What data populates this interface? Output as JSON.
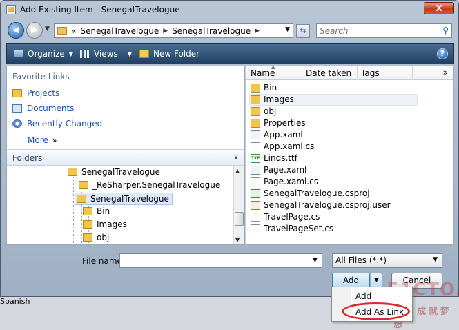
{
  "window": {
    "title": "Add Existing Item - SenegalTravelogue",
    "close_label": "X"
  },
  "nav": {
    "breadcrumb_prefix": "«",
    "breadcrumb": [
      "SenegalTravelogue",
      "SenegalTravelogue"
    ],
    "search_placeholder": "Search"
  },
  "toolbar": {
    "organize": "Organize",
    "views": "Views",
    "new_folder": "New Folder",
    "help": "?"
  },
  "favorites": {
    "title": "Favorite Links",
    "items": [
      {
        "label": "Projects",
        "icon": "folder-icon"
      },
      {
        "label": "Documents",
        "icon": "documents-icon"
      },
      {
        "label": "Recently Changed",
        "icon": "recently-changed-icon"
      }
    ],
    "more": "More",
    "more_arrow": "»"
  },
  "folders": {
    "title": "Folders",
    "caret": "∨",
    "tree": [
      {
        "label": "SenegalTravelogue",
        "indent": 1
      },
      {
        "label": "_ReSharper.SenegalTravelogue",
        "indent": 2
      },
      {
        "label": "SenegalTravelogue",
        "indent": 2,
        "selected": true
      },
      {
        "label": "Bin",
        "indent": 3
      },
      {
        "label": "Images",
        "indent": 3
      },
      {
        "label": "obj",
        "indent": 3
      }
    ]
  },
  "columns": {
    "name": "Name",
    "date": "Date taken",
    "tags": "Tags",
    "more": "»"
  },
  "files": [
    {
      "name": "Bin",
      "type": "folder"
    },
    {
      "name": "Images",
      "type": "folder"
    },
    {
      "name": "obj",
      "type": "folder"
    },
    {
      "name": "Properties",
      "type": "folder"
    },
    {
      "name": "App.xaml",
      "type": "xaml"
    },
    {
      "name": "App.xaml.cs",
      "type": "cs"
    },
    {
      "name": "Linds.ttf",
      "type": "ttf"
    },
    {
      "name": "Page.xaml",
      "type": "xaml"
    },
    {
      "name": "Page.xaml.cs",
      "type": "cs"
    },
    {
      "name": "SenegalTravelogue.csproj",
      "type": "proj"
    },
    {
      "name": "SenegalTravelogue.csproj.user",
      "type": "user"
    },
    {
      "name": "TravelPage.cs",
      "type": "cs"
    },
    {
      "name": "TravelPageSet.cs",
      "type": "cs"
    }
  ],
  "ttf_badge": "TTF",
  "filename": {
    "label": "File name:",
    "value": ""
  },
  "filter": {
    "value": "All Files (*.*)"
  },
  "buttons": {
    "add": "Add",
    "cancel": "Cancel"
  },
  "popup": {
    "items": [
      "Add",
      "Add As Link"
    ]
  },
  "below_text": "Spanish",
  "watermark": {
    "main": "51CTO.com",
    "sub": "技术成就梦想"
  },
  "colors": {
    "toolbar": "#2f5479",
    "link": "#1f4fa8",
    "highlight_ring": "#d12f2f"
  }
}
